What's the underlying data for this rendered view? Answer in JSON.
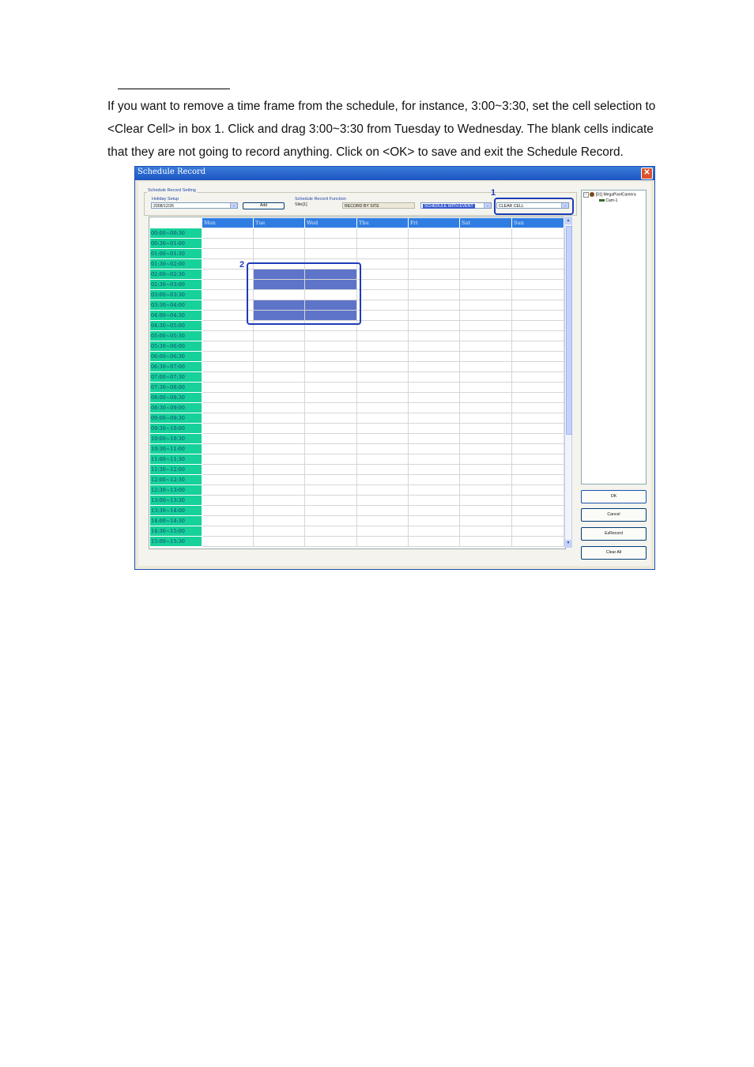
{
  "doc": {
    "paragraph_lines": [
      "If you want to remove a time frame from the schedule, for instance, 3:00~3:30, set the cell selection to",
      "<Clear Cell> in box 1. Click and drag 3:00~3:30 from Tuesday to Wednesday. The blank cells indicate",
      "that they are not going to record anything. Click on <OK> to save and exit the Schedule Record."
    ]
  },
  "window": {
    "title": "Schedule Record",
    "close": "✕"
  },
  "settings": {
    "group_label": "Schedule Record Setting",
    "holiday_label": "Holiday Setup",
    "holiday_value": "2008/12/26",
    "add_label": "Add",
    "function_label": "Schedule Record Function",
    "site_value": "Site[1]",
    "record_by": "RECORD BY SITE",
    "schedule_mode": "SCHEDULE WITH EVENT",
    "cell_selection": "CLEAR CELL",
    "arrow": "⌄"
  },
  "grid": {
    "days": [
      "Mon",
      "Tue",
      "Wed",
      "Thu",
      "Fri",
      "Sat",
      "Sun"
    ],
    "times": [
      "00:00~00:30",
      "00:30~01:00",
      "01:00~01:30",
      "01:30~02:00",
      "02:00~02:30",
      "02:30~03:00",
      "03:00~03:30",
      "03:30~04:00",
      "04:00~04:30",
      "04:30~05:00",
      "05:00~05:30",
      "05:30~06:00",
      "06:00~06:30",
      "06:30~07:00",
      "07:00~07:30",
      "07:30~08:00",
      "08:00~08:30",
      "08:30~09:00",
      "09:00~09:30",
      "09:30~10:00",
      "10:00~10:30",
      "10:30~11:00",
      "11:00~11:30",
      "11:30~12:00",
      "12:00~12:30",
      "12:30~13:00",
      "13:00~13:30",
      "13:30~14:00",
      "14:00~14:30",
      "14:30~15:00",
      "15:00~15:30"
    ],
    "selected": [
      {
        "row": 4,
        "cols": [
          1,
          2
        ]
      },
      {
        "row": 5,
        "cols": [
          1,
          2
        ]
      },
      {
        "row": 7,
        "cols": [
          1,
          2
        ]
      },
      {
        "row": 8,
        "cols": [
          1,
          2
        ]
      }
    ],
    "colors": {
      "header": "#2f7de2",
      "time": "#17d19a",
      "selected": "#5d74c9"
    }
  },
  "callouts": {
    "one": "1",
    "two": "2"
  },
  "tree": {
    "root": "[01] MegaPixelCamera",
    "child": "Cam-1"
  },
  "buttons": {
    "ok": "OK",
    "cancel": "Cancel",
    "ezrecord": "EzRecord",
    "clear_all": "Clear All"
  }
}
